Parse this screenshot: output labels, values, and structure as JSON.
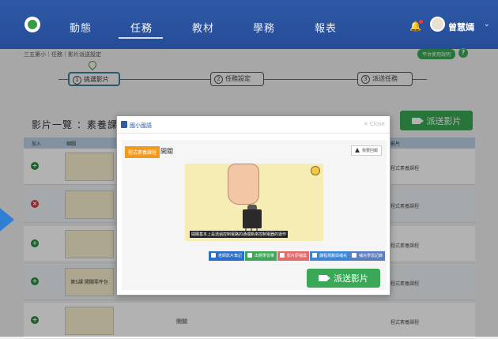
{
  "nav": {
    "items": [
      {
        "label": "動態"
      },
      {
        "label": "任務"
      },
      {
        "label": "教材"
      },
      {
        "label": "學務"
      },
      {
        "label": "報表"
      }
    ],
    "active_index": 1,
    "username": "曾慧嫣"
  },
  "breadcrumb": "三五第小｜任務｜影片派送設定",
  "help_badge": "平台使用說明",
  "help_icon": "?",
  "stepper": {
    "steps": [
      {
        "num": "1",
        "label": "挑選影片"
      },
      {
        "num": "2",
        "label": "任務設定"
      },
      {
        "num": "3",
        "label": "派送任務"
      }
    ],
    "active_index": 0
  },
  "list": {
    "title": "影片一覽 ：素養課程",
    "send_label": "派送影片",
    "columns": [
      "加入",
      "縮圖",
      "影片"
    ],
    "rows": [
      {
        "action": "+",
        "name": "",
        "category": "程式素養課程"
      },
      {
        "action": "×",
        "name": "",
        "category": "程式素養課程"
      },
      {
        "action": "+",
        "name": "",
        "category": "程式素養課程"
      },
      {
        "action": "+",
        "name": "",
        "category": "程式素養課程"
      },
      {
        "action": "+",
        "name": "開關",
        "category": "程式素養課程"
      }
    ],
    "thumb_text": "第5課 開關零件包"
  },
  "modal": {
    "title": "國小國語",
    "close_label": "✕ Close",
    "tag": "程式素養課程",
    "video_title": "開關",
    "report_label": "我要回報",
    "subtitle": "開關基本上是透過控制電路的通或斷來控制電器的運作",
    "actions": [
      {
        "label": "老師影片筆記",
        "color": "#2a6fc9"
      },
      {
        "label": "出題學習單",
        "color": "#3aa856"
      },
      {
        "label": "影片原檔案",
        "color": "#e06c6c"
      },
      {
        "label": "課程規劃與補充",
        "color": "#3b87d6"
      },
      {
        "label": "補充學習記錄",
        "color": "#5b7fbf"
      }
    ],
    "send_label": "派送影片"
  },
  "colors": {
    "nav_bg": "#2e59a8",
    "accent_green": "#3aa856",
    "tag_orange": "#f29a1f"
  }
}
